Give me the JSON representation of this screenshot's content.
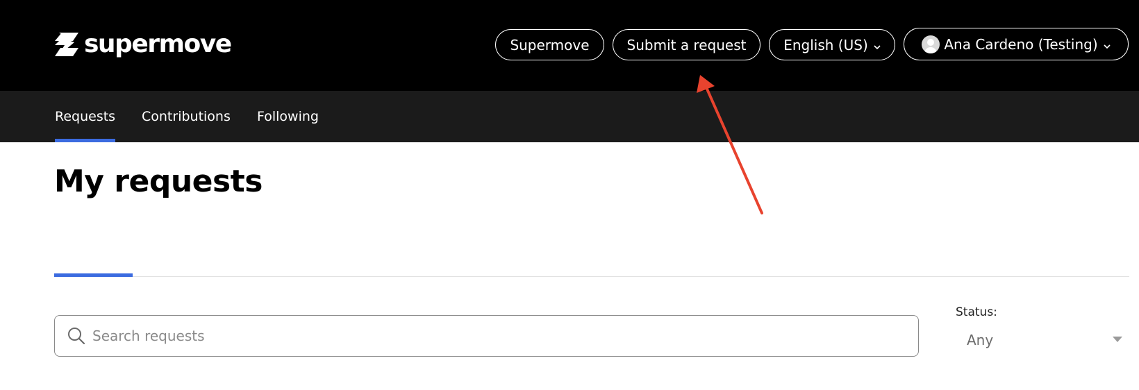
{
  "brand": {
    "name": "supermove"
  },
  "header": {
    "links": [
      {
        "label": "Supermove"
      },
      {
        "label": "Submit a request"
      }
    ],
    "language": {
      "label": "English (US)"
    },
    "user": {
      "label": "Ana Cardeno (Testing)"
    }
  },
  "subnav": {
    "items": [
      {
        "label": "Requests",
        "active": true
      },
      {
        "label": "Contributions",
        "active": false
      },
      {
        "label": "Following",
        "active": false
      }
    ]
  },
  "main": {
    "title": "My requests",
    "search": {
      "placeholder": "Search requests",
      "value": ""
    },
    "status_filter": {
      "label": "Status:",
      "value": "Any"
    }
  },
  "colors": {
    "accent": "#3b6be0",
    "annotation_arrow": "#e8432e",
    "header_bg": "#000000",
    "subnav_bg": "#1b1b1b"
  },
  "icons": {
    "logo": "supermove-logo-icon",
    "search": "search-icon",
    "chevron": "chevron-down-icon",
    "avatar": "avatar-icon",
    "select_caret": "caret-down-icon"
  }
}
